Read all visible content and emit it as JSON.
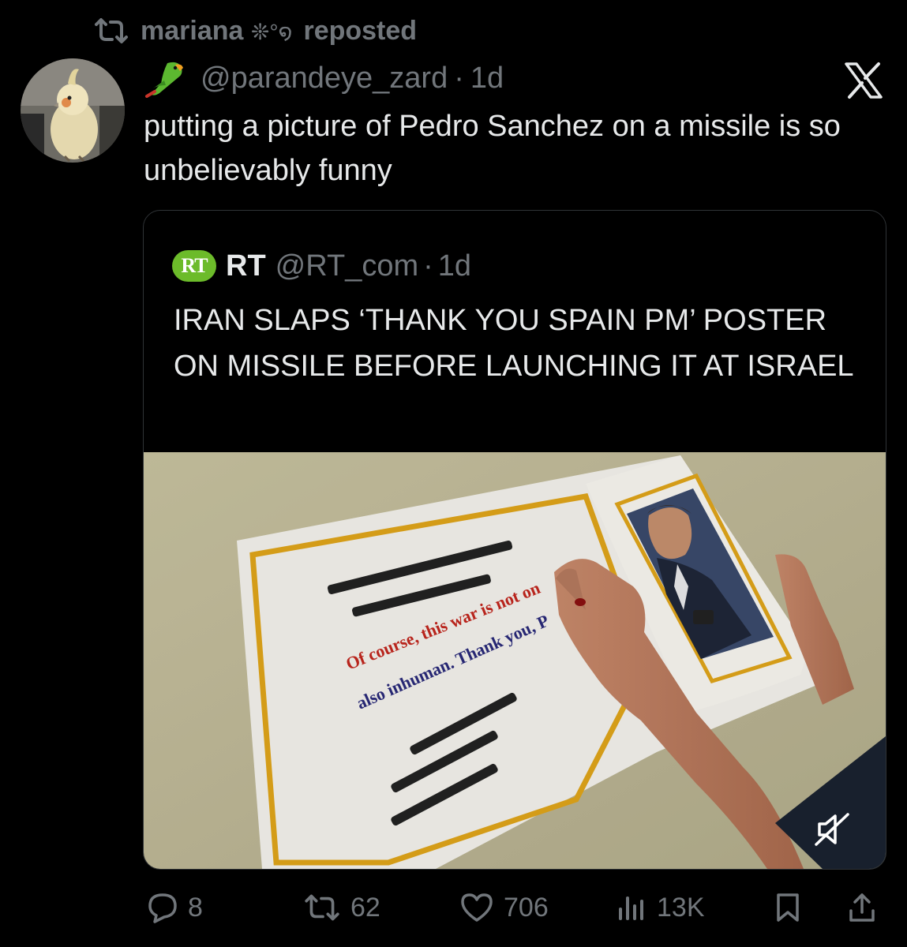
{
  "repost": {
    "user": "mariana ",
    "deco": "❊°໑",
    "suffix": "reposted"
  },
  "tweet": {
    "handle": "@parandeye_zard",
    "separator": "·",
    "time": "1d",
    "text": "putting a picture of Pedro Sanchez on a missile is so unbelievably funny"
  },
  "quoted": {
    "logo_text": "RT",
    "name": "RT",
    "handle": "@RT_com",
    "separator": "·",
    "time": "1d",
    "text": "IRAN SLAPS ‘THANK YOU SPAIN PM’ POSTER ON MISSILE BEFORE LAUNCHING IT AT ISRAEL",
    "media": {
      "poster_line1": "Of course, this war is not on",
      "poster_line2": "also inhuman. Thank you, P"
    }
  },
  "actions": {
    "replies": "8",
    "reposts": "62",
    "likes": "706",
    "views": "13K"
  },
  "colors": {
    "background": "#000000",
    "text": "#e7e9ea",
    "muted": "#71767b",
    "border": "#2f3336",
    "rt_green": "#6cbb2a"
  }
}
